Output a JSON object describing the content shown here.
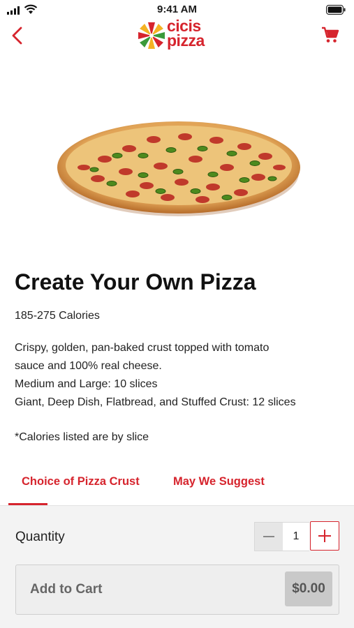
{
  "status_bar": {
    "time": "9:41 AM"
  },
  "header": {
    "logo_line1": "cicis",
    "logo_line2": "pizza",
    "back_icon": "chevron-left-icon",
    "cart_icon": "cart-icon"
  },
  "product": {
    "title": "Create Your Own Pizza",
    "calories": "185-275 Calories",
    "description_lines": [
      "Crispy, golden, pan-baked crust topped with tomato",
      "sauce and 100% real cheese.",
      "Medium and Large: 10 slices",
      "Giant, Deep Dish, Flatbread, and Stuffed Crust: 12 slices"
    ],
    "note": "*Calories listed are by slice"
  },
  "tabs": [
    {
      "label": "Choice of Pizza Crust"
    },
    {
      "label": "May We Suggest"
    }
  ],
  "order": {
    "quantity_label": "Quantity",
    "quantity": "1",
    "add_to_cart_label": "Add to Cart",
    "price": "$0.00"
  },
  "colors": {
    "brand_red": "#d6242d",
    "panel_bg": "#f3f3f3"
  }
}
